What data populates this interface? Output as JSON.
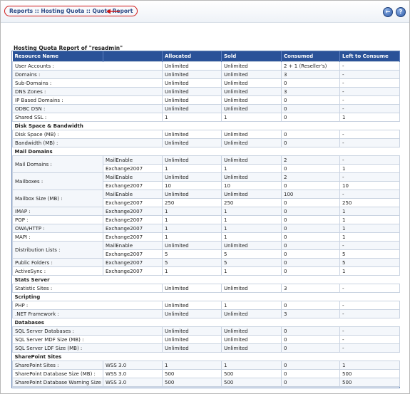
{
  "header": {
    "breadcrumb": [
      "Reports",
      "Hosting Quota",
      "Quota Report"
    ],
    "separator": " :: ",
    "back_button": "←",
    "help_button": "?"
  },
  "report": {
    "title": "Hosting Quota Report of \"resadmin\"",
    "columns": [
      "Resource Name",
      "Allocated",
      "Sold",
      "Consumed",
      "Left to Consume"
    ],
    "rows": [
      {
        "name": "User Accounts :",
        "allocated": "Unlimited",
        "sold": "Unlimited",
        "consumed": "2 + 1 (Reseller's)",
        "left": "-"
      },
      {
        "name": "Domains :",
        "allocated": "Unlimited",
        "sold": "Unlimited",
        "consumed": "3",
        "left": "-"
      },
      {
        "name": "Sub-Domains :",
        "allocated": "Unlimited",
        "sold": "Unlimited",
        "consumed": "0",
        "left": "-"
      },
      {
        "name": "DNS Zones :",
        "allocated": "Unlimited",
        "sold": "Unlimited",
        "consumed": "3",
        "left": "-"
      },
      {
        "name": "IP Based Domains :",
        "allocated": "Unlimited",
        "sold": "Unlimited",
        "consumed": "0",
        "left": "-"
      },
      {
        "name": "ODBC DSN :",
        "allocated": "Unlimited",
        "sold": "Unlimited",
        "consumed": "0",
        "left": "-"
      },
      {
        "name": "Shared SSL :",
        "allocated": "1",
        "sold": "1",
        "consumed": "0",
        "left": "1"
      },
      {
        "section": "Disk Space & Bandwidth"
      },
      {
        "name": "Disk Space (MB) :",
        "allocated": "Unlimited",
        "sold": "Unlimited",
        "consumed": "0",
        "left": "-"
      },
      {
        "name": "Bandwidth (MB) :",
        "allocated": "Unlimited",
        "sold": "Unlimited",
        "consumed": "0",
        "left": "-"
      },
      {
        "section": "Mail Domains",
        "underline": true
      },
      {
        "name": "Mail Domains :",
        "sub": [
          {
            "platform": "MailEnable",
            "allocated": "Unlimited",
            "sold": "Unlimited",
            "consumed": "2",
            "left": "-"
          },
          {
            "platform": "Exchange2007",
            "allocated": "1",
            "sold": "1",
            "consumed": "0",
            "left": "1"
          }
        ]
      },
      {
        "name": "Mailboxes :",
        "sub": [
          {
            "platform": "MailEnable",
            "allocated": "Unlimited",
            "sold": "Unlimited",
            "consumed": "2",
            "left": "-"
          },
          {
            "platform": "Exchange2007",
            "allocated": "10",
            "sold": "10",
            "consumed": "0",
            "left": "10"
          }
        ]
      },
      {
        "name": "Mailbox Size (MB) :",
        "sub": [
          {
            "platform": "MailEnable",
            "allocated": "Unlimited",
            "sold": "Unlimited",
            "consumed": "100",
            "left": "-"
          },
          {
            "platform": "Exchange2007",
            "allocated": "250",
            "sold": "250",
            "consumed": "0",
            "left": "250"
          }
        ]
      },
      {
        "name": "IMAP :",
        "platform": "Exchange2007",
        "allocated": "1",
        "sold": "1",
        "consumed": "0",
        "left": "1"
      },
      {
        "name": "POP :",
        "platform": "Exchange2007",
        "allocated": "1",
        "sold": "1",
        "consumed": "0",
        "left": "1"
      },
      {
        "name": "OWA/HTTP :",
        "platform": "Exchange2007",
        "allocated": "1",
        "sold": "1",
        "consumed": "0",
        "left": "1"
      },
      {
        "name": "MAPI :",
        "platform": "Exchange2007",
        "allocated": "1",
        "sold": "1",
        "consumed": "0",
        "left": "1"
      },
      {
        "name": "Distribution Lists :",
        "sub": [
          {
            "platform": "MailEnable",
            "allocated": "Unlimited",
            "sold": "Unlimited",
            "consumed": "0",
            "left": "-"
          },
          {
            "platform": "Exchange2007",
            "allocated": "5",
            "sold": "5",
            "consumed": "0",
            "left": "5"
          }
        ]
      },
      {
        "name": "Public Folders :",
        "platform": "Exchange2007",
        "allocated": "5",
        "sold": "5",
        "consumed": "0",
        "left": "5"
      },
      {
        "name": "ActiveSync :",
        "platform": "Exchange2007",
        "allocated": "1",
        "sold": "1",
        "consumed": "0",
        "left": "1"
      },
      {
        "section": "Stats Server"
      },
      {
        "name": "Statistic Sites :",
        "allocated": "Unlimited",
        "sold": "Unlimited",
        "consumed": "3",
        "left": "-"
      },
      {
        "section": "Scripting"
      },
      {
        "name": "PHP :",
        "allocated": "Unlimited",
        "sold": "1",
        "consumed": "0",
        "left": "-"
      },
      {
        "name": ".NET Framework :",
        "allocated": "Unlimited",
        "sold": "Unlimited",
        "consumed": "3",
        "left": "-"
      },
      {
        "section": "Databases"
      },
      {
        "name": "SQL Server Databases :",
        "allocated": "Unlimited",
        "sold": "Unlimited",
        "consumed": "0",
        "left": "-"
      },
      {
        "name": "SQL Server MDF Size (MB) :",
        "allocated": "Unlimited",
        "sold": "Unlimited",
        "consumed": "0",
        "left": "-"
      },
      {
        "name": "SQL Server LDF Size (MB) :",
        "allocated": "Unlimited",
        "sold": "Unlimited",
        "consumed": "0",
        "left": "-"
      },
      {
        "section": "SharePoint Sites"
      },
      {
        "name": "SharePoint Sites :",
        "platform": "WSS 3.0",
        "allocated": "1",
        "sold": "1",
        "consumed": "0",
        "left": "1"
      },
      {
        "name": "SharePoint Database Size (MB) :",
        "platform": "WSS 3.0",
        "allocated": "500",
        "sold": "500",
        "consumed": "0",
        "left": "500"
      },
      {
        "name": "SharePoint Database Warning Size (MB) :",
        "platform": "WSS 3.0",
        "allocated": "500",
        "sold": "500",
        "consumed": "0",
        "left": "500"
      }
    ]
  },
  "colors": {
    "header_bg": "#2a5298",
    "accent_red": "#d01818",
    "link_blue": "#2c4a86"
  }
}
